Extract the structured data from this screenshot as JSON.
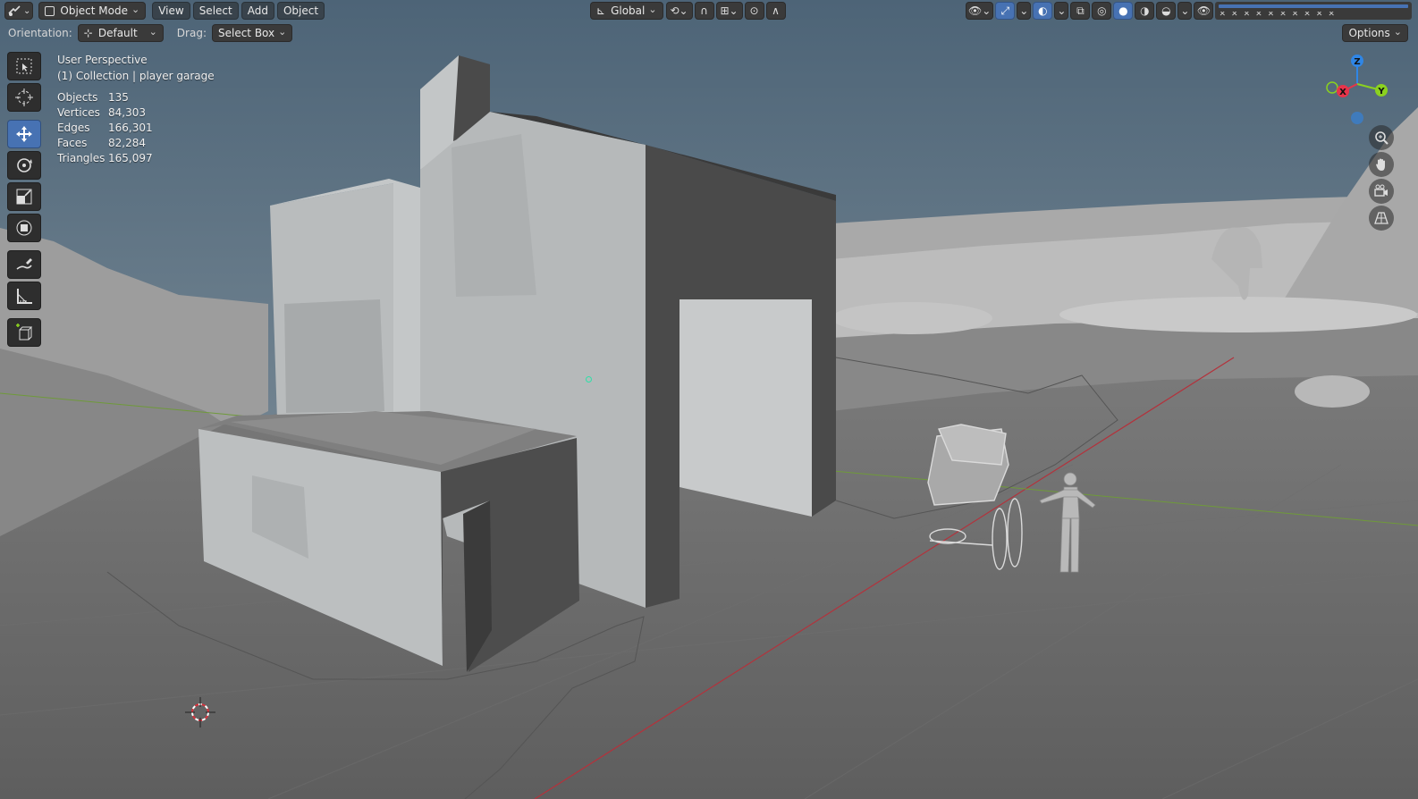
{
  "header": {
    "mode_label": "Object Mode",
    "menus": [
      "View",
      "Select",
      "Add",
      "Object"
    ],
    "transform_space": "Global",
    "options_label": "Options"
  },
  "tool_settings": {
    "orientation_label": "Orientation:",
    "orientation_value": "Default",
    "drag_label": "Drag:",
    "drag_value": "Select Box"
  },
  "overlay_info": {
    "view_name": "User Perspective",
    "collection_line": "(1) Collection | player garage",
    "stats": [
      {
        "label": "Objects",
        "value": "135"
      },
      {
        "label": "Vertices",
        "value": "84,303"
      },
      {
        "label": "Edges",
        "value": "166,301"
      },
      {
        "label": "Faces",
        "value": "82,284"
      },
      {
        "label": "Triangles",
        "value": "165,097"
      }
    ]
  },
  "gizmo": {
    "axis_labels": {
      "x": "X",
      "y": "Y",
      "z": "Z"
    },
    "colors": {
      "x": "#e8334a",
      "y": "#8bd11f",
      "z": "#2f86e6"
    }
  },
  "toolbar_tools": [
    "select-box",
    "cursor",
    "move",
    "rotate",
    "scale",
    "transform",
    "annotate",
    "measure",
    "add-cube"
  ],
  "colors": {
    "accent": "#4772b3",
    "x_axis_line": "#b3323c",
    "y_axis_line": "#6f9a3a",
    "origin": "#2fe0a8"
  }
}
